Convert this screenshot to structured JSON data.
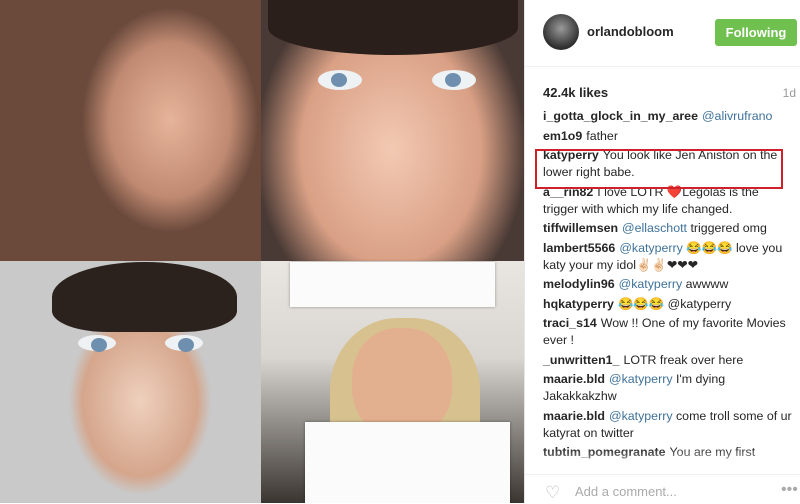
{
  "post": {
    "username": "orlandobloom",
    "follow_label": "Following",
    "likes": "42.4k likes",
    "time": "1d",
    "add_comment_placeholder": "Add a comment...",
    "more_label": "•••"
  },
  "comments": [
    {
      "user": "i_gotta_glock_in_my_aree",
      "mention": "@alivrufrano",
      "text": ""
    },
    {
      "user": "em1o9",
      "mention": "",
      "text": "father"
    },
    {
      "user": "katyperry",
      "mention": "",
      "text": "You look like Jen Aniston on the lower right babe."
    },
    {
      "user": "a__rin82",
      "mention": "",
      "text": "I love LOTR ❤️Legolas is the trigger with which my life changed."
    },
    {
      "user": "tiffwillemsen",
      "mention": "@ellaschott",
      "text": "triggered omg"
    },
    {
      "user": "lambert5566",
      "mention": "@katyperry",
      "text": "😂😂😂 love you katy your my idol✌🏻✌🏻❤❤❤"
    },
    {
      "user": "melodylin96",
      "mention": "@katyperry",
      "text": "awwww"
    },
    {
      "user": "hqkatyperry",
      "mention": "",
      "text": "😂😂😂 @katyperry"
    },
    {
      "user": "traci_s14",
      "mention": "",
      "text": "Wow !! One of my favorite Movies ever !"
    },
    {
      "user": "_unwritten1_",
      "mention": "",
      "text": "LOTR freak over here"
    },
    {
      "user": "maarie.bld",
      "mention": "@katyperry",
      "text": "I'm dying Jakakkakzhw"
    },
    {
      "user": "maarie.bld",
      "mention": "@katyperry",
      "text": "come troll some of ur katyrat on twitter"
    },
    {
      "user": "tubtim_pomegranate",
      "mention": "",
      "text": "You are my first"
    }
  ],
  "colors": {
    "follow_green": "#70c050",
    "highlight_red": "#d0212a",
    "mention_blue": "#3f729b"
  }
}
